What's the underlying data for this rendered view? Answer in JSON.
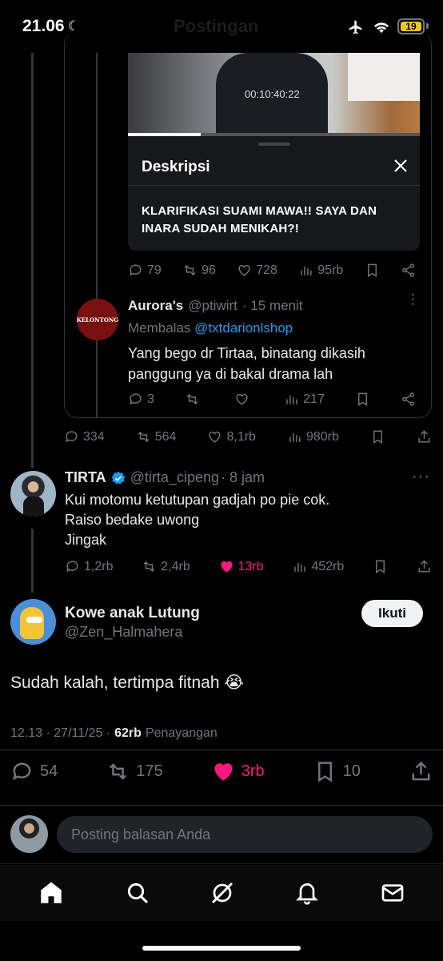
{
  "status": {
    "time": "21.06",
    "battery": "19"
  },
  "header": {
    "faded_title": "Postingan"
  },
  "video": {
    "timestamp": "00:10:40:22",
    "progress": 0.25
  },
  "description_sheet": {
    "title": "Deskripsi",
    "text": "KLARIFIKASI SUAMI MAWA!! SAYA DAN INARA SUDAH MENIKAH?!"
  },
  "quoted_actions": {
    "replies": "79",
    "reposts": "96",
    "likes": "728",
    "views": "95rb"
  },
  "aurora": {
    "name": "Aurora's",
    "handle": "@ptiwirt",
    "time": "· 15 menit",
    "replying_prefix": "Membalas",
    "replying_to": "@txtdarionlshop",
    "text_line1": "Yang bego dr Tirtaa, binatang dikasih",
    "text_line2": "panggung ya di bakal drama lah",
    "avatar_text": "KELONTONG",
    "replies": "3",
    "reposts": "",
    "likes": "",
    "views": "217"
  },
  "parent_actions": {
    "replies": "334",
    "reposts": "564",
    "likes": "8,1rb",
    "views": "980rb"
  },
  "tirta": {
    "name": "TIRTA",
    "handle": "@tirta_cipeng",
    "time": "· 8 jam",
    "line1": "Kui motomu ketutupan gadjah po pie cok.",
    "line2": "Raiso bedake uwong",
    "line3": "Jingak",
    "replies": "1,2rb",
    "reposts": "2,4rb",
    "likes": "13rb",
    "views": "452rb"
  },
  "main_post": {
    "name": "Kowe anak Lutung",
    "handle": "@Zen_Halmahera",
    "follow_label": "Ikuti",
    "text": "Sudah kalah, tertimpa fitnah 😭",
    "datetime": "12.13 · 27/11/25 ·",
    "views_count": "62rb",
    "views_label": "Penayangan",
    "replies": "54",
    "reposts": "175",
    "likes": "3rb",
    "bookmarks": "10"
  },
  "reply_box": {
    "placeholder": "Posting balasan Anda"
  },
  "nav": [
    "home-icon",
    "search-icon",
    "grok-icon",
    "notifications-icon",
    "messages-icon"
  ]
}
